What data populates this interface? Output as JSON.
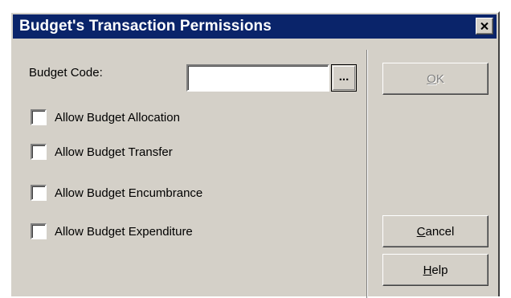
{
  "window": {
    "title": "Budget's Transaction Permissions"
  },
  "form": {
    "budget_code_label": "Budget Code:",
    "budget_code_value": "",
    "lookup_label": "...",
    "checkboxes": [
      {
        "label": "Allow Budget Allocation",
        "checked": false
      },
      {
        "label": "Allow Budget Transfer",
        "checked": false
      },
      {
        "label": "Allow Budget Encumbrance",
        "checked": false
      },
      {
        "label": "Allow Budget Expenditure",
        "checked": false
      }
    ]
  },
  "buttons": {
    "ok": {
      "mnemonic": "O",
      "rest": "K",
      "enabled": false
    },
    "cancel": {
      "mnemonic": "C",
      "rest": "ancel",
      "enabled": true
    },
    "help": {
      "mnemonic": "H",
      "rest": "elp",
      "enabled": true
    }
  },
  "icons": {
    "close": "close-icon"
  },
  "colors": {
    "titlebar": "#0a246a",
    "face": "#d4d0c8"
  }
}
